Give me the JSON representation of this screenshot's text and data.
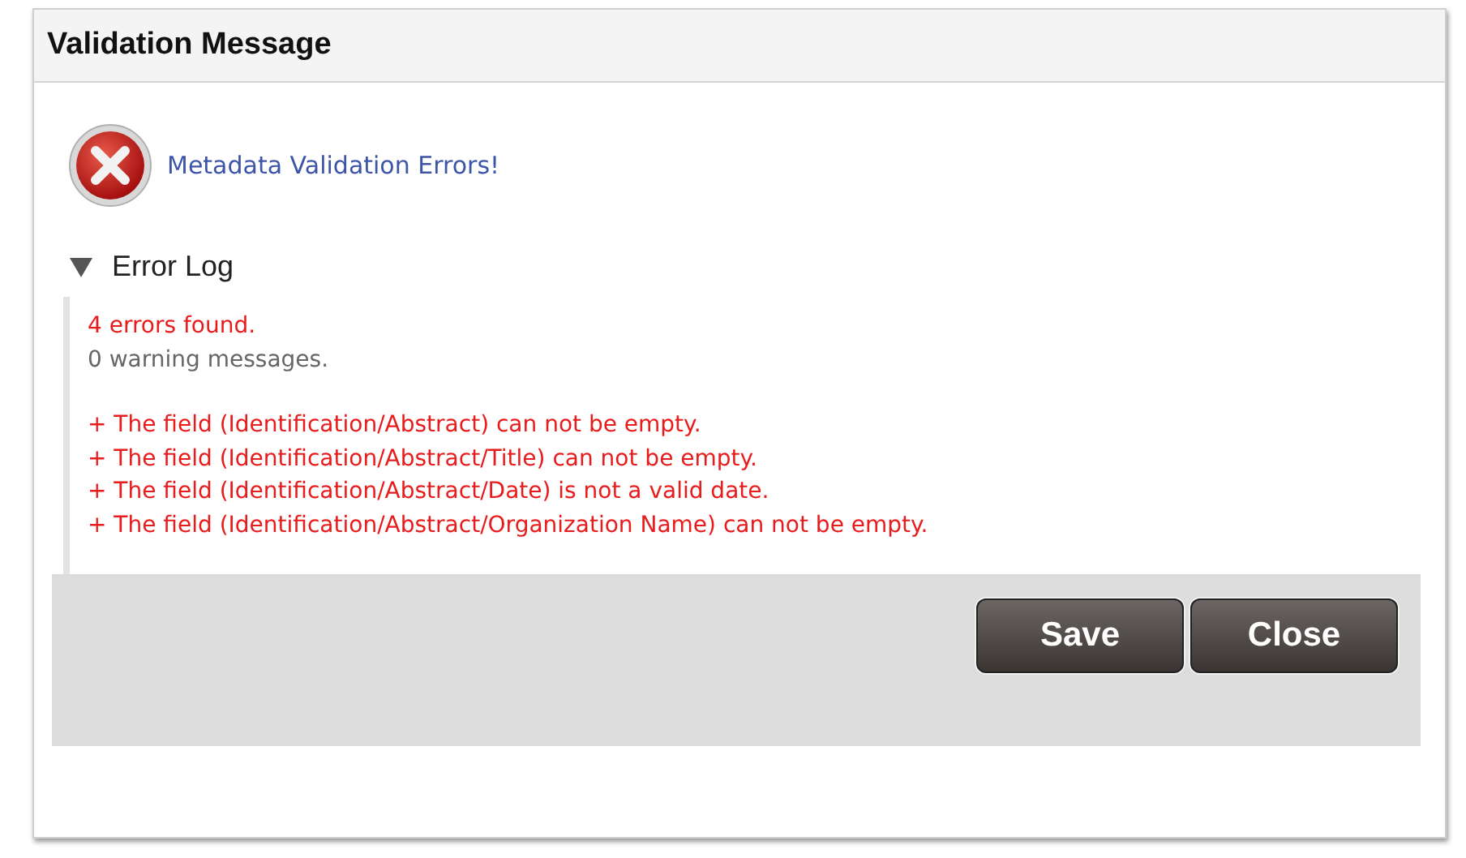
{
  "dialog": {
    "title": "Validation Message"
  },
  "status": {
    "kind": "error",
    "message": "Metadata Validation Errors!"
  },
  "log": {
    "label": "Error Log",
    "expanded": true,
    "summary": [
      {
        "kind": "error",
        "text": "4 errors found."
      },
      {
        "kind": "info",
        "text": "0 warning messages."
      }
    ],
    "messages": [
      {
        "kind": "error",
        "text": "+ The field (Identification/Abstract) can not be empty."
      },
      {
        "kind": "error",
        "text": "+ The field (Identification/Abstract/Title) can not be empty."
      },
      {
        "kind": "error",
        "text": "+ The field (Identification/Abstract/Date) is not a valid date."
      },
      {
        "kind": "error",
        "text": "+ The field (Identification/Abstract/Organization Name) can not be empty."
      }
    ]
  },
  "buttons": [
    {
      "label": "Save"
    },
    {
      "label": "Close"
    }
  ]
}
